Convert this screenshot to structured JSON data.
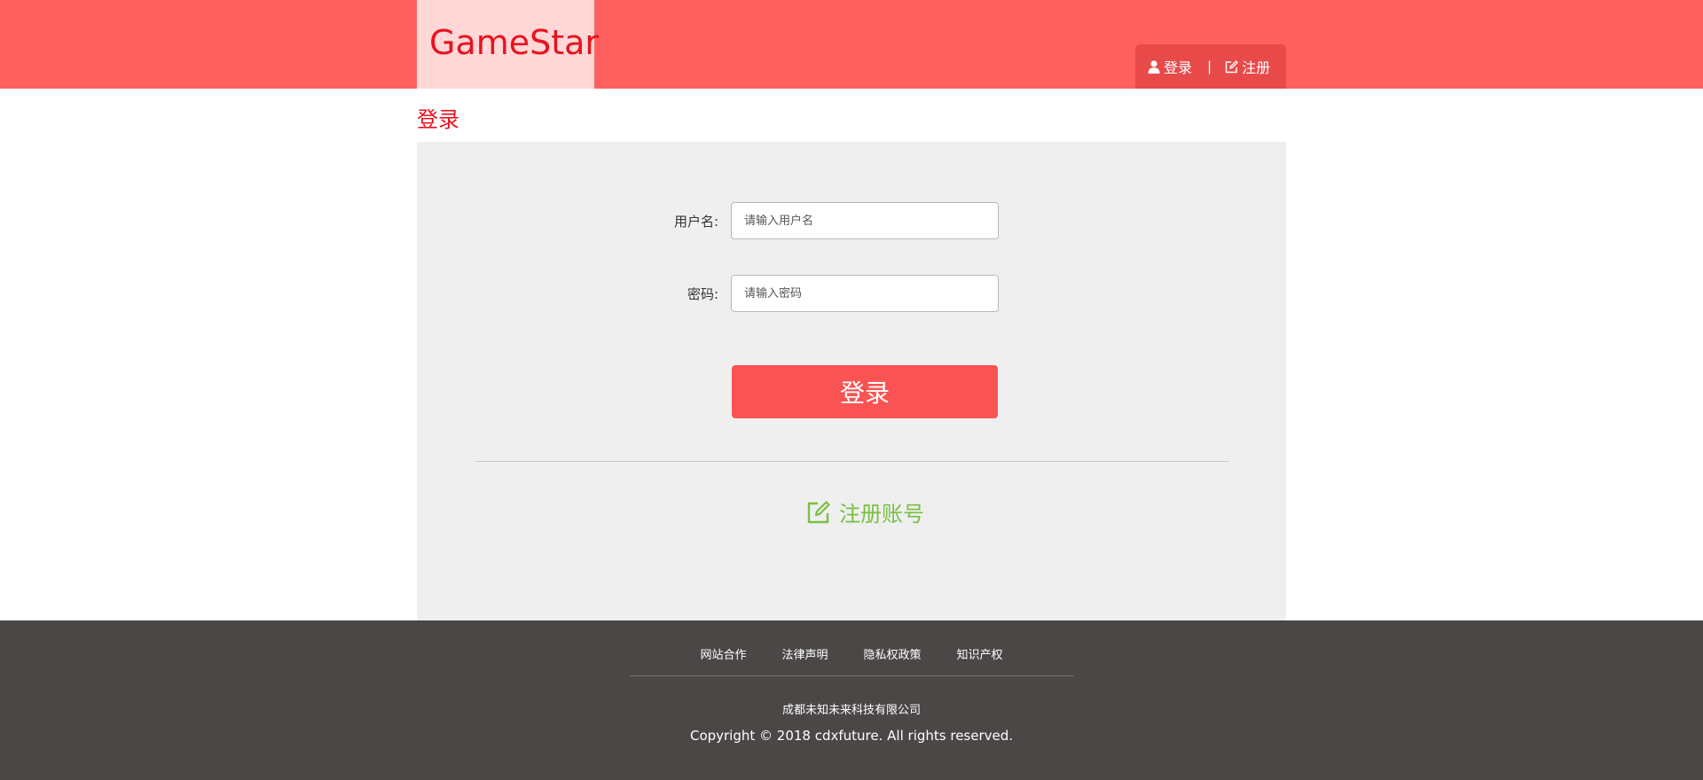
{
  "header": {
    "logo": "GameStar",
    "login_label": "登录",
    "separator": "|",
    "register_label": "注册"
  },
  "page": {
    "title": "登录"
  },
  "form": {
    "username_label": "用户名:",
    "username_placeholder": "请输入用户名",
    "password_label": "密码:",
    "password_placeholder": "请输入密码",
    "submit_label": "登录",
    "register_link": "注册账号"
  },
  "footer": {
    "links": [
      "网站合作",
      "法律声明",
      "隐私权政策",
      "知识产权"
    ],
    "company": "成都未知未来科技有限公司",
    "copyright": "Copyright © 2018 cdxfuture. All rights reserved."
  },
  "colors": {
    "header_bg": "#ff5f5f",
    "logo_bg": "#ffd7d7",
    "accent_red": "#e8121e",
    "button_red": "#f95353",
    "register_green": "#7ac043",
    "footer_bg": "#4b4747",
    "panel_bg": "#efefef"
  },
  "icons": {
    "login": "user-icon",
    "register": "edit-icon"
  }
}
